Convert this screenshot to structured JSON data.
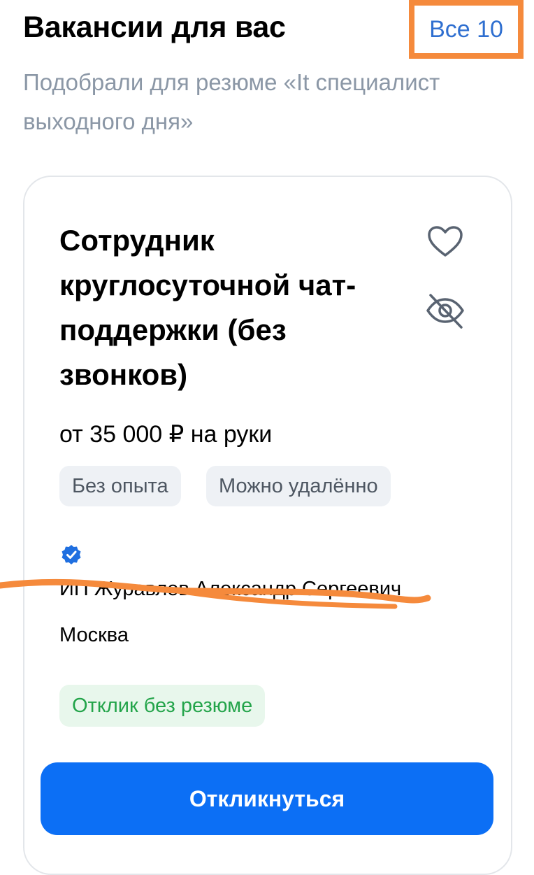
{
  "header": {
    "title": "Вакансии для вас",
    "all_link": "Все 10",
    "subtitle": "Подобрали для резюме «It специалист выходного дня»"
  },
  "vacancy": {
    "title": "Сотрудник круглосуточной чат-поддержки (без звонков)",
    "salary": "от 35 000 ₽ на руки",
    "tags": [
      "Без опыта",
      "Можно удалённо"
    ],
    "company": "ИП Журавлев Александр Сергеевич",
    "city": "Москва",
    "badge": "Отклик без резюме",
    "respond_label": "Откликнуться"
  },
  "icons": {
    "favorite": "heart-icon",
    "hide": "eye-off-icon",
    "verified": "verified-badge-icon"
  },
  "colors": {
    "accent": "#0c6ff5",
    "link": "#2f6fd0",
    "highlight": "#f58a3c",
    "success": "#23a44a",
    "muted": "#8b97a6"
  }
}
